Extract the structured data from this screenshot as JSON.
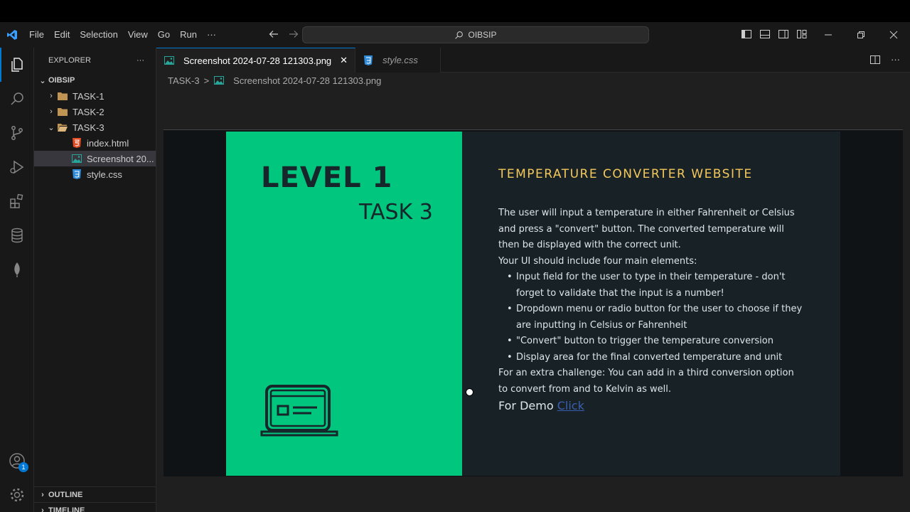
{
  "menu": [
    "File",
    "Edit",
    "Selection",
    "View",
    "Go",
    "Run",
    "···"
  ],
  "command_center": {
    "text": "OIBSIP"
  },
  "explorer": {
    "title": "EXPLORER",
    "more": "···",
    "root": "OIBSIP",
    "items": [
      {
        "label": "TASK-1"
      },
      {
        "label": "TASK-2"
      },
      {
        "label": "TASK-3"
      },
      {
        "label": "index.html"
      },
      {
        "label": "Screenshot 20..."
      },
      {
        "label": "style.css"
      }
    ],
    "outline": "OUTLINE",
    "timeline": "TIMELINE"
  },
  "account_badge": "1",
  "tabs": [
    {
      "label": "Screenshot 2024-07-28 121303.png",
      "close": "✕"
    },
    {
      "label": "style.css"
    }
  ],
  "breadcrumb": {
    "folder": "TASK-3",
    "sep": ">",
    "file": "Screenshot 2024-07-28 121303.png"
  },
  "image": {
    "level": "LEVEL 1",
    "task": "TASK 3",
    "heading": "TEMPERATURE CONVERTER WEBSITE",
    "p1": "The user will input a temperature in either Fahrenheit or Celsius and press a \"convert\" button. The converted temperature will then be displayed with the correct unit.",
    "p2": "Your UI should include four main elements:",
    "bullets": [
      "Input field for the user to type in their temperature - don't forget to validate that the input is a number!",
      "Dropdown menu or radio button for the user to choose if they are inputting in Celsius or Fahrenheit",
      "\"Convert\" button to trigger the temperature conversion",
      "Display area for the final converted temperature and unit"
    ],
    "p3": "For an extra challenge: You can add in a third conversion option to convert from and to Kelvin as well.",
    "demo_label": "For Demo",
    "demo_link": "Click"
  },
  "colors": {
    "accent": "#0078d4",
    "green_panel": "#00c67e",
    "heading": "#f4c85a"
  }
}
